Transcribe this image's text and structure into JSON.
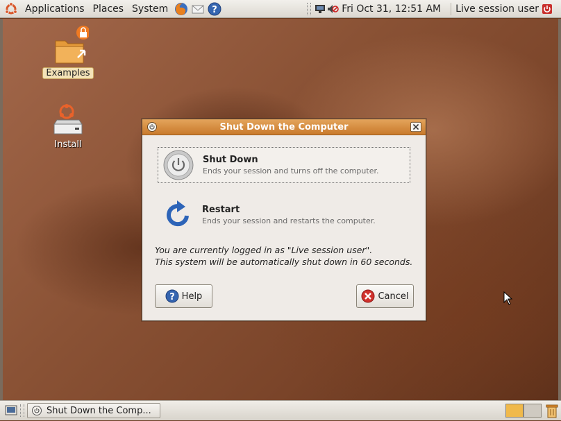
{
  "top_panel": {
    "menus": [
      "Applications",
      "Places",
      "System"
    ],
    "clock": "Fri Oct 31, 12:51 AM",
    "user": "Live session user"
  },
  "desktop": {
    "icons": [
      {
        "label": "Examples",
        "icon": "folder-icon"
      },
      {
        "label": "Install",
        "icon": "drive-icon"
      }
    ]
  },
  "dialog": {
    "title": "Shut Down the Computer",
    "options": [
      {
        "title": "Shut Down",
        "description": "Ends your session and turns off the computer.",
        "icon": "power-icon"
      },
      {
        "title": "Restart",
        "description": "Ends your session and restarts the computer.",
        "icon": "restart-icon"
      }
    ],
    "message_line1": "You are currently logged in as \"Live session user\".",
    "message_line2": "This system will be automatically shut down in 60 seconds.",
    "help_label": "Help",
    "cancel_label": "Cancel"
  },
  "bottom_panel": {
    "task_label": "Shut Down the Comp..."
  },
  "colors": {
    "titlebar": "#d58a3c",
    "workspace_active": "#f0b94b",
    "desktop": "#8a5235"
  }
}
